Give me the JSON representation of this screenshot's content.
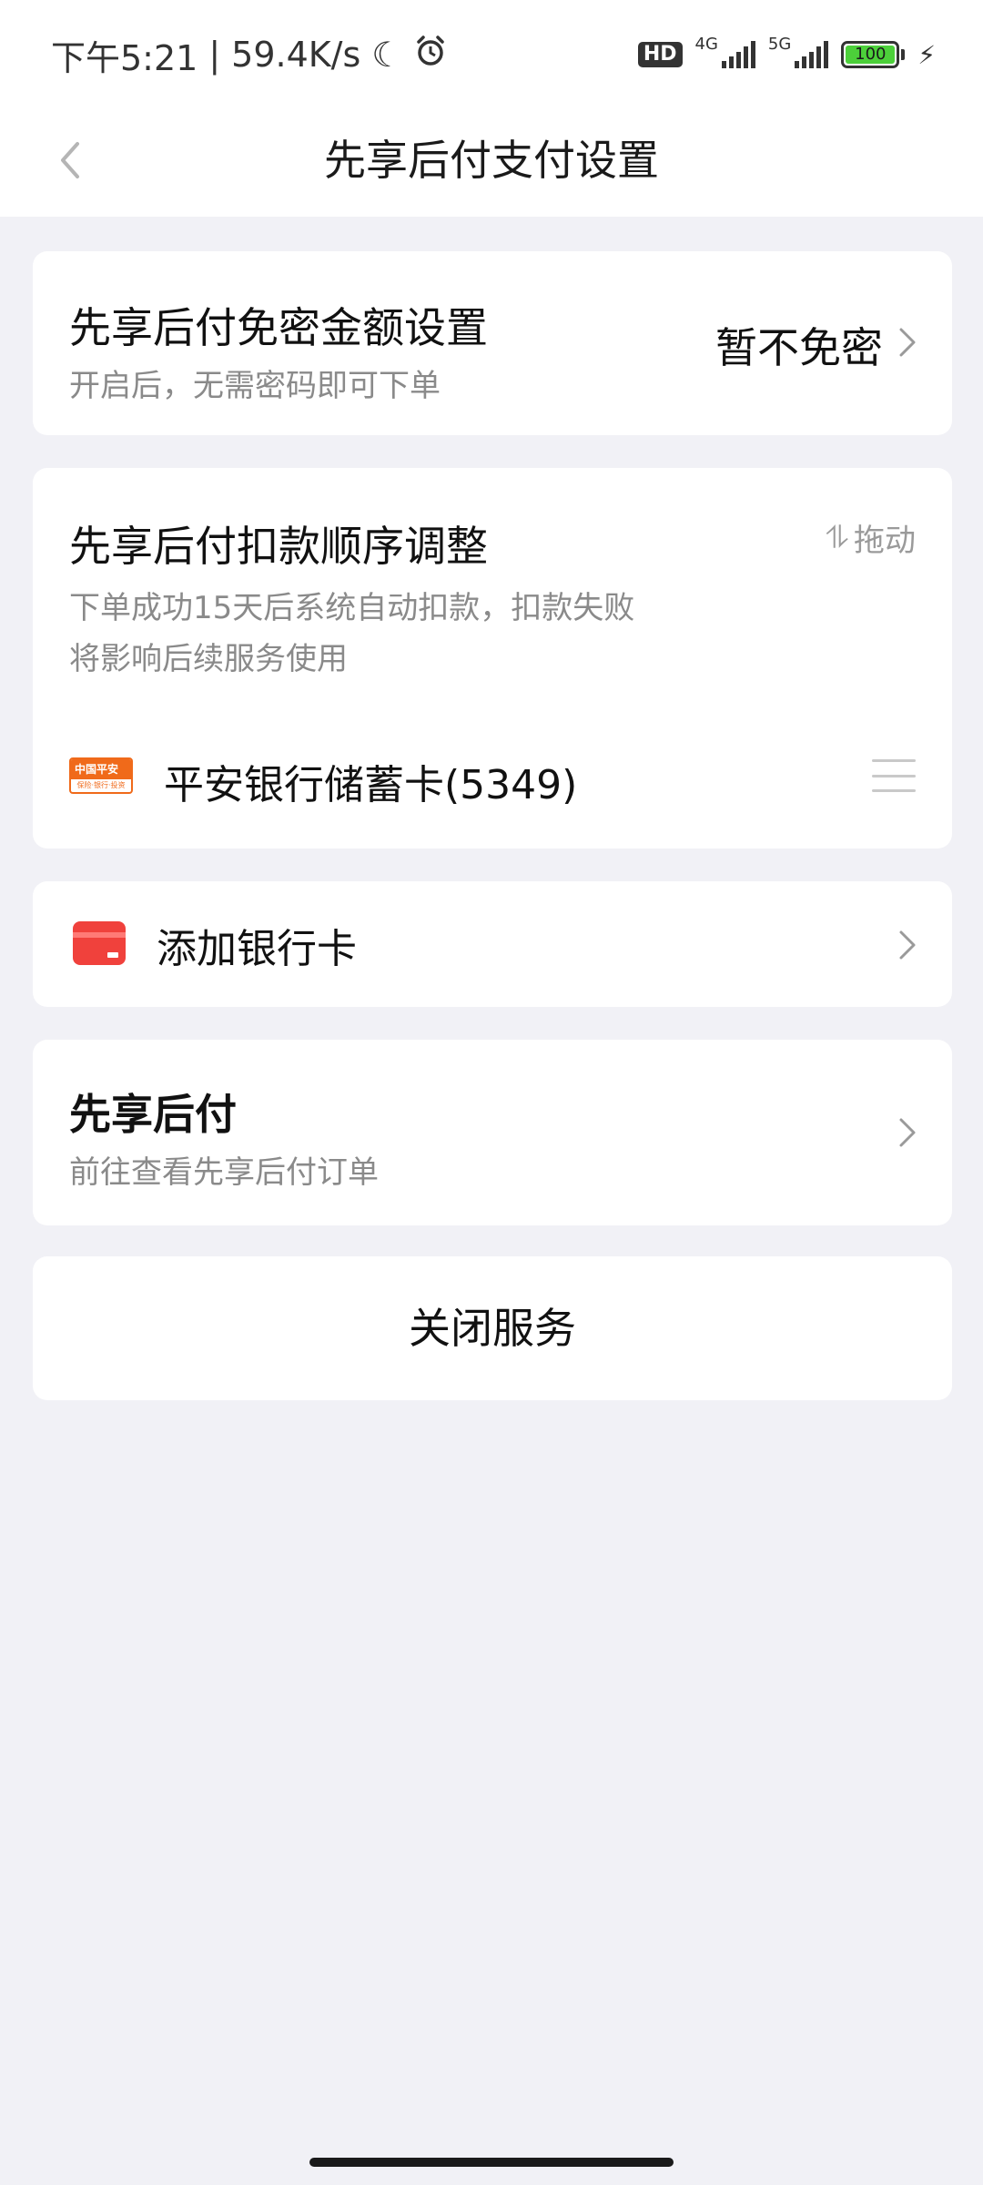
{
  "status_bar": {
    "time": "下午5:21",
    "separator": "|",
    "net_speed": "59.4K/s",
    "hd_badge": "HD",
    "net_4g": "4G",
    "net_5g": "5G",
    "battery_level": "100"
  },
  "nav": {
    "title": "先享后付支付设置"
  },
  "password_setting": {
    "title": "先享后付免密金额设置",
    "subtitle": "开启后，无需密码即可下单",
    "value": "暂不免密"
  },
  "deduction_order": {
    "title": "先享后付扣款顺序调整",
    "drag_hint": "拖动",
    "drag_hint_icon": "⥮",
    "subtitle_line1": "下单成功15天后系统自动扣款，扣款失败",
    "subtitle_line2": "将影响后续服务使用",
    "bank_logo_text": "中国平安",
    "bank_logo_sub": "保险·银行·投资",
    "bank_card": "平安银行储蓄卡(5349)"
  },
  "add_card": {
    "label": "添加银行卡"
  },
  "bnpl": {
    "title": "先享后付",
    "subtitle": "前往查看先享后付订单"
  },
  "close_service": {
    "label": "关闭服务"
  },
  "colors": {
    "page_bg": "#f1f1f6",
    "card_bg": "#ffffff",
    "accent_red": "#f0413c",
    "pingan_orange": "#f06a1a",
    "battery_green": "#4cd03a"
  }
}
